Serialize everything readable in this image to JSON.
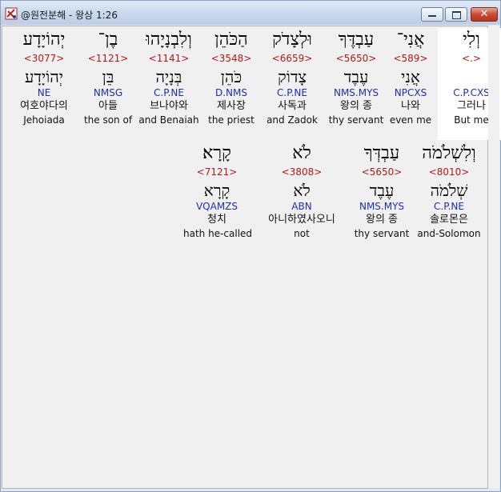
{
  "window": {
    "title": "@원전분해 - 왕상 1:26",
    "buttons": {
      "minimize": "",
      "maximize": "",
      "close": "✕"
    }
  },
  "rows": [
    {
      "words": [
        {
          "hebrew": "וְלִי",
          "strong": "<.>",
          "lemma": "",
          "morph": "C.P.CXS",
          "korean": "그러나",
          "english": "But me",
          "highlighted": true
        },
        {
          "hebrew": "אֲנִי־",
          "strong": "<589>",
          "lemma": "אֲנִי",
          "morph": "NPCXS",
          "korean": "나와",
          "english": "even me"
        },
        {
          "hebrew": "עַבְדֶּךָ",
          "strong": "<5650>",
          "lemma": "עֶבֶד",
          "morph": "NMS.MYS",
          "korean": "왕의 종",
          "english": "thy servant"
        },
        {
          "hebrew": "וּלְצָדֹק",
          "strong": "<6659>",
          "lemma": "צָדוֹק",
          "morph": "C.P.NE",
          "korean": "사독과",
          "english": "and Zadok"
        },
        {
          "hebrew": "הַכֹּהֵן",
          "strong": "<3548>",
          "lemma": "כֹּהֵן",
          "morph": "D.NMS",
          "korean": "제사장",
          "english": "the priest"
        },
        {
          "hebrew": "וְלִבְנָיָהוּ",
          "strong": "<1141>",
          "lemma": "בְּנָיָה",
          "morph": "C.P.NE",
          "korean": "브나야와",
          "english": "and Benaiah"
        },
        {
          "hebrew": "בֶן־",
          "strong": "<1121>",
          "lemma": "בֵּן",
          "morph": "NMSG",
          "korean": "아들",
          "english": "the son of"
        },
        {
          "hebrew": "יְהוֹיָדָע",
          "strong": "<3077>",
          "lemma": "יְהוֹיָדָע",
          "morph": "NE",
          "korean": "여호야다의",
          "english": "Jehoiada"
        }
      ]
    },
    {
      "words": [
        {
          "hebrew": "וְלִשְׁלֹמֹה",
          "strong": "<8010>",
          "lemma": "שְׁלֹמֹה",
          "morph": "C.P.NE",
          "korean": "솔로몬은",
          "english": "and-Solomon"
        },
        {
          "hebrew": "עַבְדְּךָ",
          "strong": "<5650>",
          "lemma": "עֶבֶד",
          "morph": "NMS.MYS",
          "korean": "왕의 종",
          "english": "thy servant"
        },
        {
          "hebrew": "לֹא",
          "strong": "<3808>",
          "lemma": "לֹא",
          "morph": "ABN",
          "korean": "아니하였사오니",
          "english": "not"
        },
        {
          "hebrew": "קָרָא׃",
          "strong": "<7121>",
          "lemma": "קָרָא",
          "morph": "VQAMZS",
          "korean": "청치",
          "english": "hath he-called"
        }
      ]
    }
  ],
  "colors": {
    "strong": "#b01818",
    "morph": "#1a2fb0",
    "background": "#f0f0f0",
    "highlight": "#ffffff"
  }
}
